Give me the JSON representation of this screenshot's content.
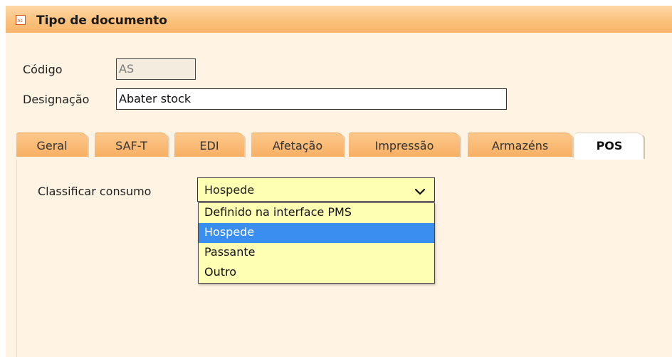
{
  "window": {
    "title": "Tipo de documento",
    "icon": "document-as-icon"
  },
  "form": {
    "codigo_label": "Código",
    "codigo_value": "AS",
    "designacao_label": "Designação",
    "designacao_value": "Abater stock"
  },
  "tabs": [
    {
      "label": "Geral",
      "active": false
    },
    {
      "label": "SAF-T",
      "active": false
    },
    {
      "label": "EDI",
      "active": false
    },
    {
      "label": "Afetação",
      "active": false
    },
    {
      "label": "Impressão",
      "active": false
    },
    {
      "label": "Armazéns",
      "active": false
    },
    {
      "label": "POS",
      "active": true
    }
  ],
  "pos": {
    "classificar_label": "Classificar consumo",
    "selected_value": "Hospede",
    "options": [
      {
        "label": "Definido na interface PMS",
        "selected": false
      },
      {
        "label": "Hospede",
        "selected": true
      },
      {
        "label": "Passante",
        "selected": false
      },
      {
        "label": "Outro",
        "selected": false
      }
    ]
  },
  "colors": {
    "titlebar": "#fbc27d",
    "tab": "#f8b064",
    "panel": "#fff4e4",
    "select_bg": "#ffffb3",
    "highlight": "#3a8ef0"
  }
}
